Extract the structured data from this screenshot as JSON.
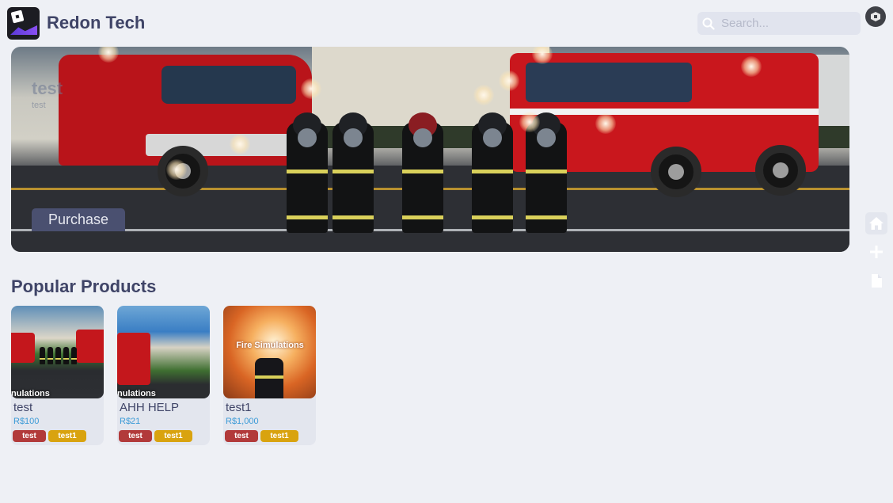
{
  "header": {
    "brand": "Redon Tech",
    "search_placeholder": "Search..."
  },
  "hero": {
    "title": "test",
    "subtitle": "test",
    "purchase_label": "Purchase"
  },
  "sidebar": {
    "items": [
      {
        "icon": "home-icon"
      },
      {
        "icon": "plus-icon"
      },
      {
        "icon": "document-icon"
      }
    ]
  },
  "popular": {
    "title": "Popular Products",
    "products": [
      {
        "name": "test",
        "price": "R$100",
        "thumb_text": "nulations",
        "tags": [
          "test",
          "test1"
        ]
      },
      {
        "name": "AHH HELP",
        "price": "R$21",
        "thumb_text": "nulations",
        "tags": [
          "test",
          "test1"
        ]
      },
      {
        "name": "test1",
        "price": "R$1,000",
        "thumb_text": "Fire Simulations",
        "tags": [
          "test",
          "test1"
        ]
      }
    ]
  },
  "colors": {
    "background": "#eef0f5",
    "text": "#3f4467",
    "price": "#3b9bd7",
    "tag_red": "#b23a3a",
    "tag_gold": "#d9a30f"
  }
}
